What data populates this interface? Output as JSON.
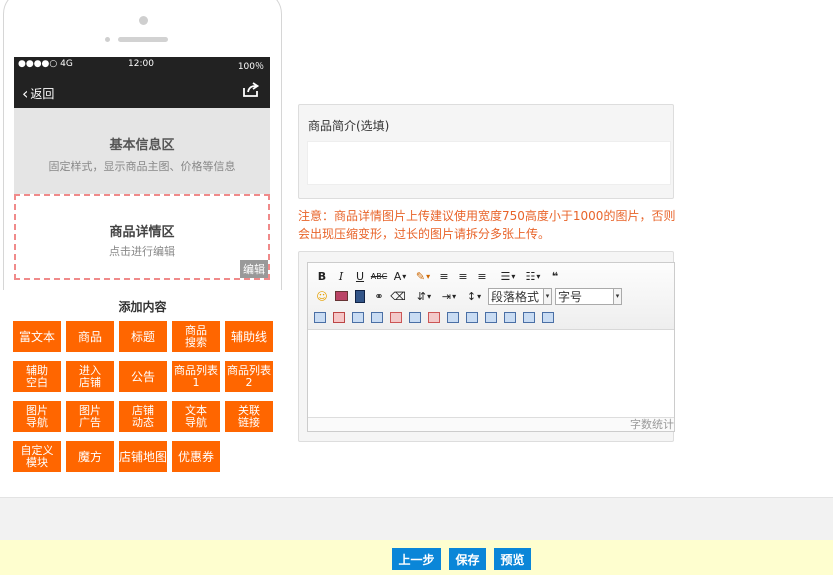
{
  "phone": {
    "status": {
      "signal": "●●●●○ 4G",
      "time": "12:00",
      "battery": "100％"
    },
    "nav": {
      "back_label": "返回"
    },
    "basic_section": {
      "title": "基本信息区",
      "subtitle": "固定样式，显示商品主图、价格等信息"
    },
    "detail_section": {
      "title": "商品详情区",
      "subtitle": "点击进行编辑",
      "edit_label": "编辑"
    }
  },
  "add_panel": {
    "title": "添加内容",
    "items": [
      {
        "label": "富文本"
      },
      {
        "label": "商品"
      },
      {
        "label": "标题"
      },
      {
        "label": "商品\n搜索"
      },
      {
        "label": "辅助线"
      },
      {
        "label": "辅助\n空白"
      },
      {
        "label": "进入\n店铺"
      },
      {
        "label": "公告"
      },
      {
        "label": "商品列表\n1"
      },
      {
        "label": "商品列表\n2"
      },
      {
        "label": "图片\n导航"
      },
      {
        "label": "图片\n广告"
      },
      {
        "label": "店铺\n动态"
      },
      {
        "label": "文本\n导航"
      },
      {
        "label": "关联\n链接"
      },
      {
        "label": "自定义\n模块"
      },
      {
        "label": "魔方"
      },
      {
        "label": "店铺地图"
      },
      {
        "label": "优惠券"
      }
    ]
  },
  "intro": {
    "label": "商品简介(选填)",
    "value": ""
  },
  "notice": "注意：商品详情图片上传建议使用宽度750高度小于1000的图片，否则会出现压缩变形，过长的图片请拆分多张上传。",
  "editor": {
    "toolbar_row1": [
      "B",
      "I",
      "U",
      "ABC",
      "A",
      "✎",
      "≡",
      "≡",
      "≡",
      "☰",
      "☷",
      "❝"
    ],
    "paragraph_select": "段落格式",
    "fontsize_select": "字号",
    "word_count_label": "字数统计"
  },
  "footer": {
    "prev_label": "上一步",
    "save_label": "保存",
    "preview_label": "预览"
  },
  "colors": {
    "accent_orange": "#ff6600",
    "notice": "#e8642a",
    "button_blue": "#0a86d8"
  }
}
